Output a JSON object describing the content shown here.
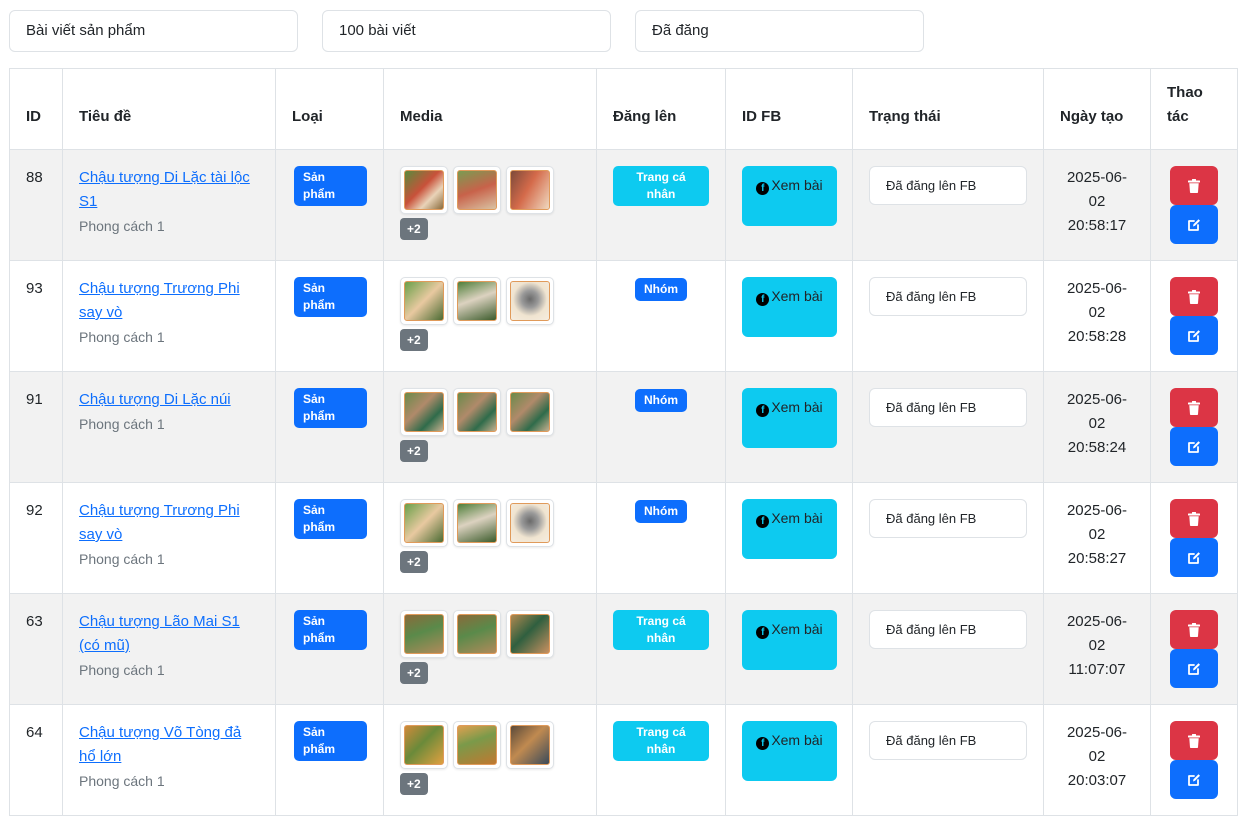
{
  "filters": [
    {
      "value": "Bài viết sản phẩm"
    },
    {
      "value": "100 bài viết"
    },
    {
      "value": "Đã đăng"
    }
  ],
  "columns": [
    "ID",
    "Tiêu đề",
    "Loại",
    "Media",
    "Đăng lên",
    "ID FB",
    "Trạng thái",
    "Ngày tạo",
    "Thao tác"
  ],
  "rows": [
    {
      "id": "88",
      "title": "Chậu tượng Di Lặc tài lộc S1",
      "style": "Phong cách 1",
      "type": "Sản phẩm",
      "more": "+2",
      "target": "Trang cá nhân",
      "target_color": "cyan",
      "fb": "Xem bài",
      "status": "Đã đăng lên FB",
      "date": "2025-06-02 20:58:17",
      "thumbs": [
        "t-a",
        "t-b",
        "t-c"
      ]
    },
    {
      "id": "93",
      "title": "Chậu tượng Trương Phi say vò",
      "style": "Phong cách 1",
      "type": "Sản phẩm",
      "more": "+2",
      "target": "Nhóm",
      "target_color": "blue",
      "fb": "Xem bài",
      "status": "Đã đăng lên FB",
      "date": "2025-06-02 20:58:28",
      "thumbs": [
        "t-d",
        "t-e",
        "t-f"
      ]
    },
    {
      "id": "91",
      "title": "Chậu tượng Di Lặc núi",
      "style": "Phong cách 1",
      "type": "Sản phẩm",
      "more": "+2",
      "target": "Nhóm",
      "target_color": "blue",
      "fb": "Xem bài",
      "status": "Đã đăng lên FB",
      "date": "2025-06-02 20:58:24",
      "thumbs": [
        "t-g",
        "t-g",
        "t-g"
      ]
    },
    {
      "id": "92",
      "title": "Chậu tượng Trương Phi say vò",
      "style": "Phong cách 1",
      "type": "Sản phẩm",
      "more": "+2",
      "target": "Nhóm",
      "target_color": "blue",
      "fb": "Xem bài",
      "status": "Đã đăng lên FB",
      "date": "2025-06-02 20:58:27",
      "thumbs": [
        "t-d",
        "t-e",
        "t-f"
      ]
    },
    {
      "id": "63",
      "title": "Chậu tượng Lão Mai S1 (có mũ)",
      "style": "Phong cách 1",
      "type": "Sản phẩm",
      "more": "+2",
      "target": "Trang cá nhân",
      "target_color": "cyan",
      "fb": "Xem bài",
      "status": "Đã đăng lên FB",
      "date": "2025-06-02 11:07:07",
      "thumbs": [
        "t-h",
        "t-h",
        "t-i"
      ]
    },
    {
      "id": "64",
      "title": "Chậu tượng Võ Tòng đả hổ lớn",
      "style": "Phong cách 1",
      "type": "Sản phẩm",
      "more": "+2",
      "target": "Trang cá nhân",
      "target_color": "cyan",
      "fb": "Xem bài",
      "status": "Đã đăng lên FB",
      "date": "2025-06-02 20:03:07",
      "thumbs": [
        "t-j",
        "t-k",
        "t-l"
      ]
    }
  ],
  "colors": {
    "primary": "#0d6efd",
    "info": "#0dcaf0",
    "danger": "#dc3545",
    "secondary": "#6c757d"
  },
  "icons": {
    "fb": "facebook-icon",
    "delete": "trash-icon",
    "edit": "edit-icon"
  }
}
